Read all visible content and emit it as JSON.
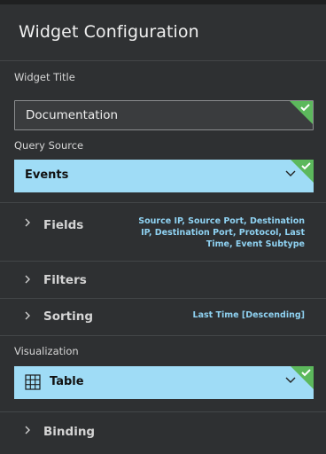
{
  "header": {
    "title": "Widget Configuration"
  },
  "widget_title": {
    "label": "Widget Title",
    "value": "Documentation"
  },
  "query_source": {
    "label": "Query Source",
    "value": "Events"
  },
  "sections": {
    "fields": {
      "name": "Fields",
      "summary_lines": [
        "Source IP, Source Port, Destination",
        "IP, Destination Port, Protocol, Last",
        "Time, Event Subtype"
      ]
    },
    "filters": {
      "name": "Filters"
    },
    "sorting": {
      "name": "Sorting",
      "summary": "Last Time [Descending]"
    },
    "binding": {
      "name": "Binding"
    }
  },
  "visualization": {
    "label": "Visualization",
    "value": "Table",
    "icon": "table-icon"
  },
  "colors": {
    "background": "#2e3032",
    "select_fill": "#9fdcf6",
    "valid_check": "#5cb85c",
    "summary_text": "#8fd2f2"
  }
}
